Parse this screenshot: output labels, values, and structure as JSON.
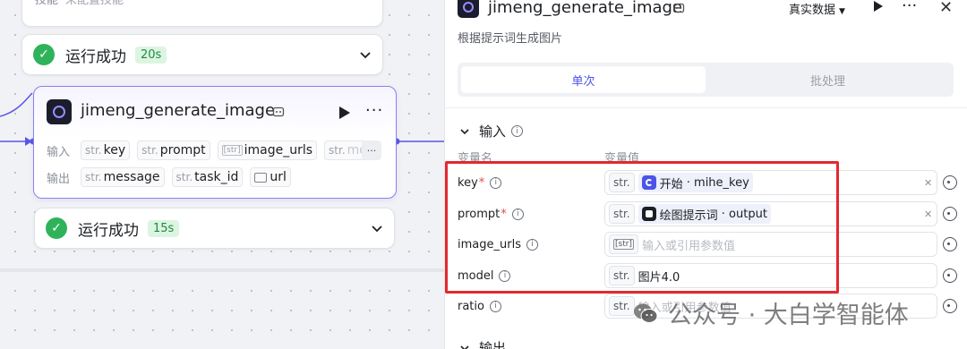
{
  "canvas": {
    "top_card": {
      "label": "技能",
      "value": "未配置技能"
    },
    "status_1": {
      "text": "运行成功",
      "time": "20s"
    },
    "status_2": {
      "text": "运行成功",
      "time": "15s"
    },
    "node": {
      "title": "jimeng_generate_image",
      "input_label": "输入",
      "output_label": "输出",
      "inputs": [
        {
          "type": "str.",
          "name": "key"
        },
        {
          "type": "str.",
          "name": "prompt"
        },
        {
          "type": "[str]",
          "name": "image_urls"
        },
        {
          "type": "str.",
          "name": "mo"
        }
      ],
      "outputs": [
        {
          "type": "str.",
          "name": "message"
        },
        {
          "type": "str.",
          "name": "task_id"
        },
        {
          "type": "",
          "name": "url"
        }
      ],
      "more_label": "···"
    }
  },
  "panel": {
    "title": "jimeng_generate_image",
    "data_mode": "真实数据",
    "description": "根据提示词生成图片",
    "tabs": [
      {
        "label": "单次",
        "active": true
      },
      {
        "label": "批处理",
        "active": false
      }
    ],
    "section_title": "输入",
    "col_name": "变量名",
    "col_value": "变量值",
    "params": [
      {
        "name": "key",
        "required": true,
        "type": "str.",
        "ref_node": "开始",
        "ref_var": "mihe_key"
      },
      {
        "name": "prompt",
        "required": true,
        "type": "str.",
        "ref_node": "绘图提示词",
        "ref_var": "output"
      },
      {
        "name": "image_urls",
        "required": false,
        "type": "[str]",
        "placeholder": "输入或引用参数值"
      },
      {
        "name": "model",
        "required": false,
        "type": "str.",
        "value": "图片4.0"
      },
      {
        "name": "ratio",
        "required": false,
        "type": "str.",
        "placeholder": "输入或引用参数值"
      }
    ],
    "footer_section": "输出"
  },
  "watermark": {
    "text": "公众号 · 大白学智能体"
  },
  "colors": {
    "accent": "#4d53e8",
    "success": "#2fb35a",
    "highlight": "#e3282e",
    "node_border": "#8c80f0"
  },
  "icons": [
    "check-icon",
    "chevron-down-icon",
    "play-icon",
    "more-icon",
    "close-icon",
    "info-icon",
    "reference-icon",
    "bot-icon",
    "wechat-icon"
  ]
}
